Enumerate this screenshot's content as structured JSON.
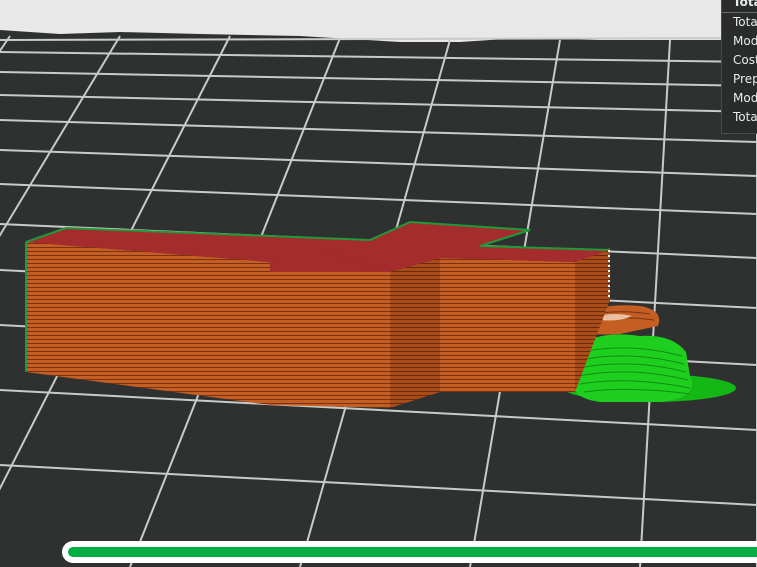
{
  "stats_panel": {
    "header": "Tota",
    "rows": [
      "Tota",
      "Mod",
      "Cost",
      "Prep",
      "Mod",
      "Tota"
    ]
  },
  "progress": {
    "fraction": 1.0
  },
  "colors": {
    "background": "#2f3131",
    "grid_line": "#c9cbcb",
    "top_face": "#a52c2c",
    "side_face": "#c45e22",
    "layer_line": "#7a3210",
    "support": "#1fcf1f",
    "outline": "#1f9a3a",
    "progress": "#00ae42"
  }
}
